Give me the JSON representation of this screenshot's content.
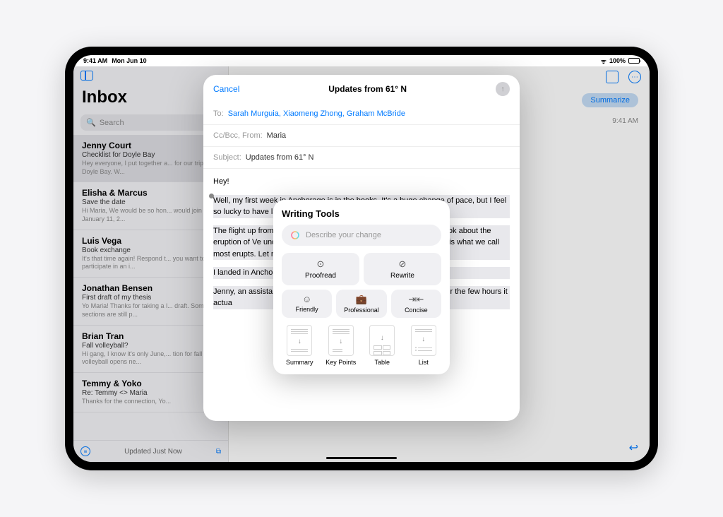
{
  "status": {
    "time": "9:41 AM",
    "date": "Mon Jun 10",
    "battery": "100%"
  },
  "sidebar": {
    "title": "Inbox",
    "search_placeholder": "Search",
    "footer_status": "Updated Just Now",
    "items": [
      {
        "sender": "Jenny Court",
        "subject": "Checklist for Doyle Bay",
        "preview": "Hey everyone, I put together a... for our trip up to Doyle Bay. W..."
      },
      {
        "sender": "Elisha & Marcus",
        "subject": "Save the date",
        "preview": "Hi Maria, We would be so hon... would join us on January 11, 2..."
      },
      {
        "sender": "Luis Vega",
        "subject": "Book exchange",
        "preview": "It's that time again! Respond t... you want to participate in an i..."
      },
      {
        "sender": "Jonathan Bensen",
        "subject": "First draft of my thesis",
        "preview": "Yo Maria! Thanks for taking a l... draft. Some sections are still p..."
      },
      {
        "sender": "Brian Tran",
        "subject": "Fall volleyball?",
        "preview": "Hi gang, I know it's only June,... tion for fall volleyball opens ne..."
      },
      {
        "sender": "Temmy & Yoko",
        "subject": "Re: Temmy <> Maria",
        "preview": "Thanks for the connection, Yo..."
      }
    ]
  },
  "content": {
    "summarize": "Summarize",
    "time": "9:41 AM"
  },
  "compose": {
    "cancel": "Cancel",
    "title": "Updates from 61° N",
    "to_label": "To:",
    "recipients": "Sarah Murguia, Xiaomeng Zhong, Graham McBride",
    "ccbcc_label": "Cc/Bcc, From:",
    "from_value": "Maria",
    "subject_label": "Subject:",
    "subject_value": "Updates from 61° N",
    "body": {
      "greeting": "Hey!",
      "p1": "Well, my first week in Anchorage is in the books. It's a huge change of pace, but I feel so lucky to have la                                                                                                this was the longest week of my life, in",
      "p2": "The flight up from                                                                                                  of the flight reading. I've been on a hist                                                                                                    tty solid book about the eruption of Ve                                                                                                  und Pompeii. It's a little dry at points                                                                                                         rd: tephra, which is what we call most                                                                                               erupts. Let me know if you find a way t",
      "p3": "I landed in Anchor                                                                                                     ould still be out, it was so trippy to s",
      "p4": "Jenny, an assistar                                                                                                     ne airport. She told me the first thing                                                                                                         ly sleeping for the few hours it actua"
    }
  },
  "writing_tools": {
    "title": "Writing Tools",
    "input_placeholder": "Describe your change",
    "proofread": "Proofread",
    "rewrite": "Rewrite",
    "friendly": "Friendly",
    "professional": "Professional",
    "concise": "Concise",
    "summary": "Summary",
    "keypoints": "Key Points",
    "table": "Table",
    "list": "List"
  }
}
